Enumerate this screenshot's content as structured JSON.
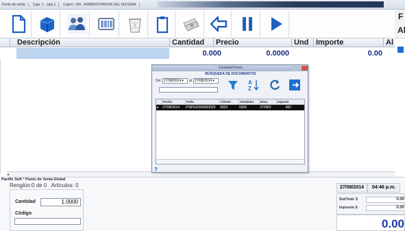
{
  "titlebar": {
    "app": "Punto de venta",
    "caja": "Caja: 1 · caja 1",
    "cajero": "Cajero: 100 · ADMINISTRADOR DEL SISTEMA"
  },
  "toolbar": {
    "buttons": [
      {
        "name": "new-document",
        "icon": "document-icon"
      },
      {
        "name": "open",
        "icon": "cube-icon"
      },
      {
        "name": "customers",
        "icon": "users-icon"
      },
      {
        "name": "barcode",
        "icon": "barcode-icon"
      },
      {
        "name": "delete",
        "icon": "trash-icon"
      },
      {
        "name": "clipboard",
        "icon": "clipboard-icon"
      },
      {
        "name": "payment",
        "icon": "money-icon"
      },
      {
        "name": "back",
        "icon": "arrow-left-icon"
      },
      {
        "name": "pause",
        "icon": "pause-icon"
      },
      {
        "name": "play",
        "icon": "play-icon"
      }
    ]
  },
  "grid": {
    "headers": [
      "Descripción",
      "Cantidad",
      "Precio",
      "Und",
      "Importe",
      "Al"
    ],
    "row": {
      "cantidad": "0.000",
      "precio": "0.0000",
      "importe": "0.00"
    }
  },
  "right_panel": {
    "top_label": "F",
    "second_label": "Al"
  },
  "footer": {
    "brand": "Pacific Soft * Punto de Venta Global",
    "renglon": "Renglón:0 de 0",
    "articulos": "Artículos: 0",
    "cantidad_label": "Cantidad",
    "cantidad_value": "1.0000",
    "codigo_label": "Código",
    "codigo_value": "",
    "date": "27/08/2014",
    "time": "04:46 p.m.",
    "subtotal_label": "SubTotal: $",
    "subtotal_value": "0.00",
    "impuesto_label": "Impuesto $",
    "impuesto_value": "0.00",
    "total": "0.00"
  },
  "dialog": {
    "title_bg": "Cantidad          Precio",
    "subtitle": "BÚSQUEDA DE DOCUMENTOS",
    "del_label": "Del",
    "date_from": "27/08/2014",
    "al_label": "al",
    "date_to": "27/08/2014",
    "search_value": "",
    "grid_headers": [
      "Fecha",
      "Folio",
      "Cliente",
      "Vendedor",
      "Hora",
      "Importe"
    ],
    "rows": [
      {
        "marker": "▸",
        "fecha": "27/08/2014",
        "folio": "PSIPED000000029",
        "cliente": "0003",
        "vendedor": "0005",
        "hora": "27/08/2",
        "importe": "482"
      }
    ],
    "help": "?"
  },
  "colors": {
    "accent": "#1f5fbf",
    "selection": "#bcd4ee",
    "total_text": "#1a3aa8"
  }
}
